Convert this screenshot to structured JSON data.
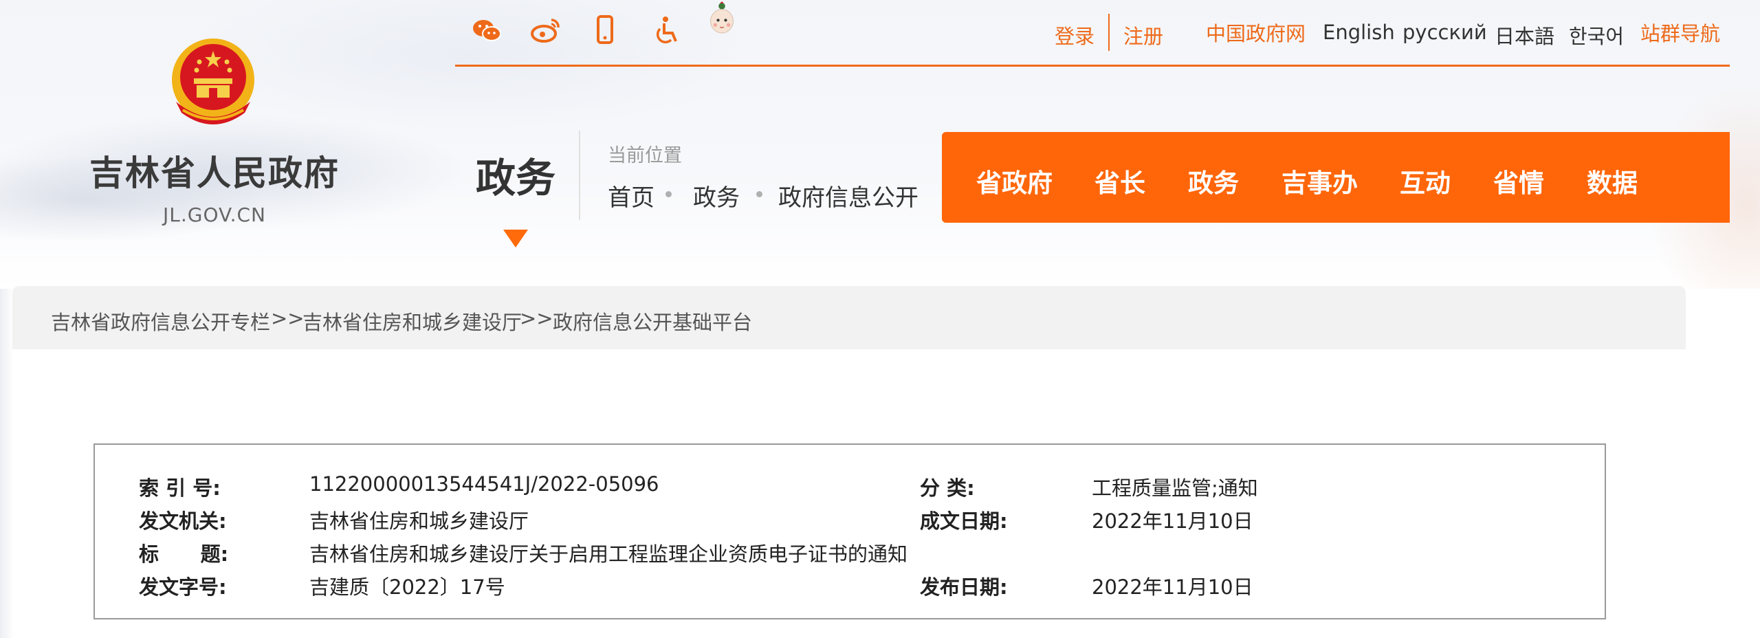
{
  "site": {
    "title": "吉林省人民政府",
    "domain": "JL.GOV.CN"
  },
  "top_icons": [
    "wechat-icon",
    "weibo-icon",
    "mobile-icon",
    "accessibility-icon",
    "mascot-icon"
  ],
  "top_links": {
    "login": "登录",
    "register": "注册",
    "gov_portal": "中国政府网",
    "english": "English",
    "russian": "русский",
    "japanese": "日本語",
    "korean": "한국어",
    "site_nav": "站群导航"
  },
  "section": {
    "label": "政务",
    "current_position_label": "当前位置",
    "breadcrumb": [
      "首页",
      "政务",
      "政府信息公开"
    ]
  },
  "main_nav": [
    "省政府",
    "省长",
    "政务",
    "吉事办",
    "互动",
    "省情",
    "数据"
  ],
  "path_bar": {
    "items": [
      "吉林省政府信息公开专栏",
      "吉林省住房和城乡建设厅",
      "政府信息公开基础平台"
    ],
    "separator": ">>"
  },
  "meta": {
    "index_label": "索  引 号:",
    "index_value": "11220000013544541J/2022-05096",
    "category_label": "分  类:",
    "category_value": "工程质量监管;通知",
    "issuer_label": "发文机关:",
    "issuer_value": "吉林省住房和城乡建设厅",
    "written_date_label": "成文日期:",
    "written_date_value": "2022年11月10日",
    "title_label": "标      题:",
    "title_value": "吉林省住房和城乡建设厅关于启用工程监理企业资质电子证书的通知",
    "doc_no_label": "发文字号:",
    "doc_no_value": "吉建质〔2022〕17号",
    "publish_date_label": "发布日期:",
    "publish_date_value": "2022年11月10日"
  },
  "colors": {
    "accent": "#ff660a",
    "link_orange": "#ee6a1a",
    "emblem_red": "#d7171f",
    "emblem_gold": "#f2b318"
  }
}
